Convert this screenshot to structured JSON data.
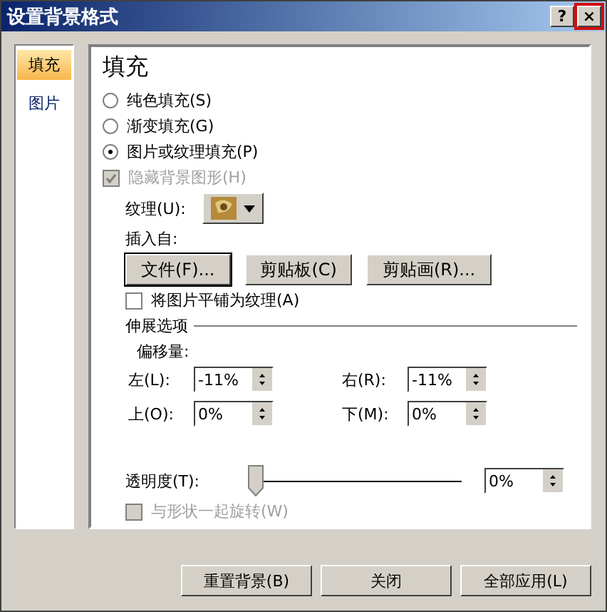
{
  "window": {
    "title": "设置背景格式",
    "help": "?",
    "close": "×"
  },
  "sidebar": {
    "items": [
      {
        "label": "填充",
        "selected": true
      },
      {
        "label": "图片",
        "selected": false
      }
    ]
  },
  "fill": {
    "heading": "填充",
    "options": [
      {
        "label": "纯色填充(S)",
        "selected": false
      },
      {
        "label": "渐变填充(G)",
        "selected": false
      },
      {
        "label": "图片或纹理填充(P)",
        "selected": true
      }
    ],
    "hide_background": {
      "label": "隐藏背景图形(H)",
      "checked": true,
      "disabled": true
    },
    "texture_label": "纹理(U):",
    "insert_label": "插入自:",
    "insert_buttons": [
      {
        "label": "文件(F)...",
        "focused": true
      },
      {
        "label": "剪贴板(C)",
        "focused": false
      },
      {
        "label": "剪贴画(R)...",
        "focused": false
      }
    ],
    "tile": {
      "label": "将图片平铺为纹理(A)",
      "checked": false,
      "disabled": false
    },
    "stretch": {
      "title": "伸展选项",
      "offset_label": "偏移量:",
      "fields": [
        {
          "label": "左(L):",
          "value": "-11%"
        },
        {
          "label": "右(R):",
          "value": "-11%"
        },
        {
          "label": "上(O):",
          "value": "0%"
        },
        {
          "label": "下(M):",
          "value": "0%"
        }
      ]
    },
    "transparency": {
      "label": "透明度(T):",
      "level": 0,
      "value": "0%"
    },
    "rotate": {
      "label": "与形状一起旋转(W)",
      "checked": false,
      "disabled": true
    }
  },
  "buttons": [
    "重置背景(B)",
    "关闭",
    "全部应用(L)"
  ]
}
